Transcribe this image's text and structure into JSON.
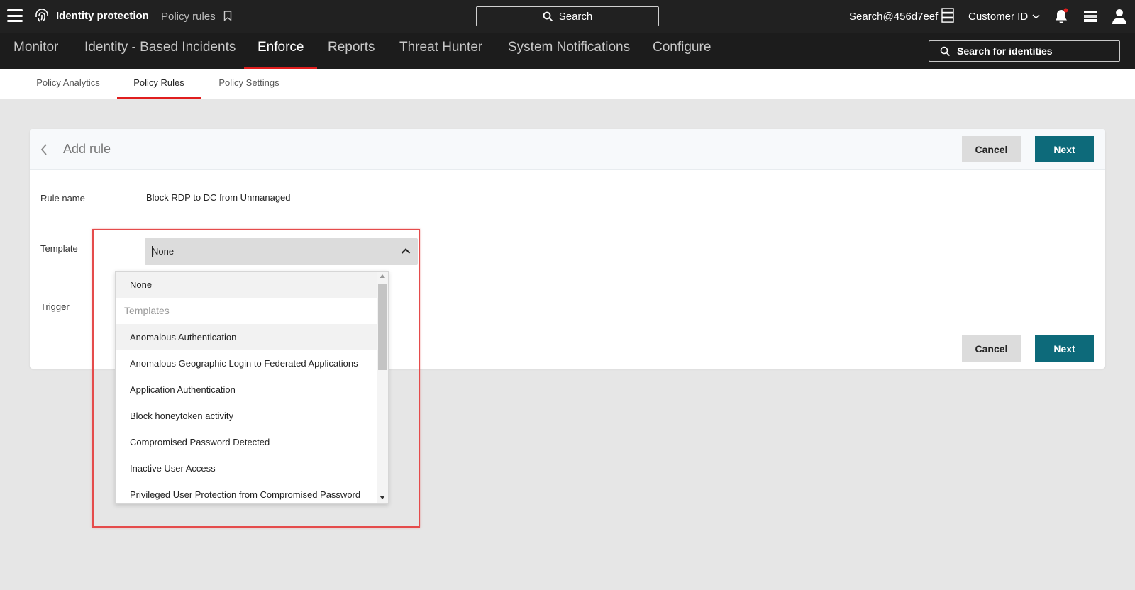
{
  "topbar": {
    "brand": "Identity protection",
    "page": "Policy rules",
    "search_label": "Search",
    "account": "Search@456d7eef",
    "customer_label": "Customer ID"
  },
  "nav": {
    "tabs": [
      {
        "label": "Monitor"
      },
      {
        "label": "Identity - Based Incidents"
      },
      {
        "label": "Enforce",
        "active": true
      },
      {
        "label": "Reports"
      },
      {
        "label": "Threat Hunter"
      },
      {
        "label": "System Notifications"
      },
      {
        "label": "Configure"
      }
    ],
    "identity_search": "Search for identities"
  },
  "subnav": {
    "tabs": [
      {
        "label": "Policy Analytics"
      },
      {
        "label": "Policy Rules",
        "active": true
      },
      {
        "label": "Policy Settings"
      }
    ]
  },
  "form": {
    "title": "Add rule",
    "cancel_label": "Cancel",
    "next_label": "Next",
    "rule_name_label": "Rule name",
    "rule_name_value": "Block RDP to DC from Unmanaged",
    "template_label": "Template",
    "template_value": "None",
    "trigger_label": "Trigger"
  },
  "dropdown": {
    "options": [
      {
        "label": "None",
        "highlighted": true
      },
      {
        "label": "Templates",
        "group": true
      },
      {
        "label": "Anomalous Authentication",
        "highlighted": true
      },
      {
        "label": "Anomalous Geographic Login to Federated Applications"
      },
      {
        "label": "Application Authentication"
      },
      {
        "label": "Block honeytoken activity"
      },
      {
        "label": "Compromised Password Detected"
      },
      {
        "label": "Inactive User Access"
      },
      {
        "label": "Privileged User Protection from Compromised Password"
      }
    ]
  },
  "colors": {
    "accent_red": "#e01e1e",
    "primary_button": "#0d6a7a",
    "topbar_bg": "#212121",
    "highlight_box": "#e54b4b"
  }
}
